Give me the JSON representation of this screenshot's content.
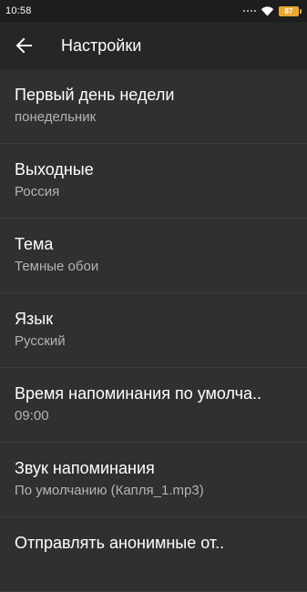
{
  "status_bar": {
    "time": "10:58",
    "battery_level": "87"
  },
  "toolbar": {
    "title": "Настройки"
  },
  "settings": [
    {
      "title": "Первый день недели",
      "value": "понедельник"
    },
    {
      "title": "Выходные",
      "value": "Россия"
    },
    {
      "title": "Тема",
      "value": "Темные обои"
    },
    {
      "title": "Язык",
      "value": "Русский"
    },
    {
      "title": "Время напоминания по умолча..",
      "value": "09:00"
    },
    {
      "title": "Звук напоминания",
      "value": "По умолчанию (Капля_1.mp3)"
    },
    {
      "title": "Отправлять анонимные от..",
      "value": ""
    }
  ],
  "colors": {
    "background": "#303030",
    "toolbar": "#262626",
    "status_bar": "#1e1e1e",
    "battery": "#e9a930",
    "secondary_text": "#b3b3b3"
  },
  "icons": {
    "back": "arrow-back-icon",
    "wifi": "wifi-icon",
    "signal_dots": "signal-dots-icon",
    "battery": "battery-icon"
  }
}
